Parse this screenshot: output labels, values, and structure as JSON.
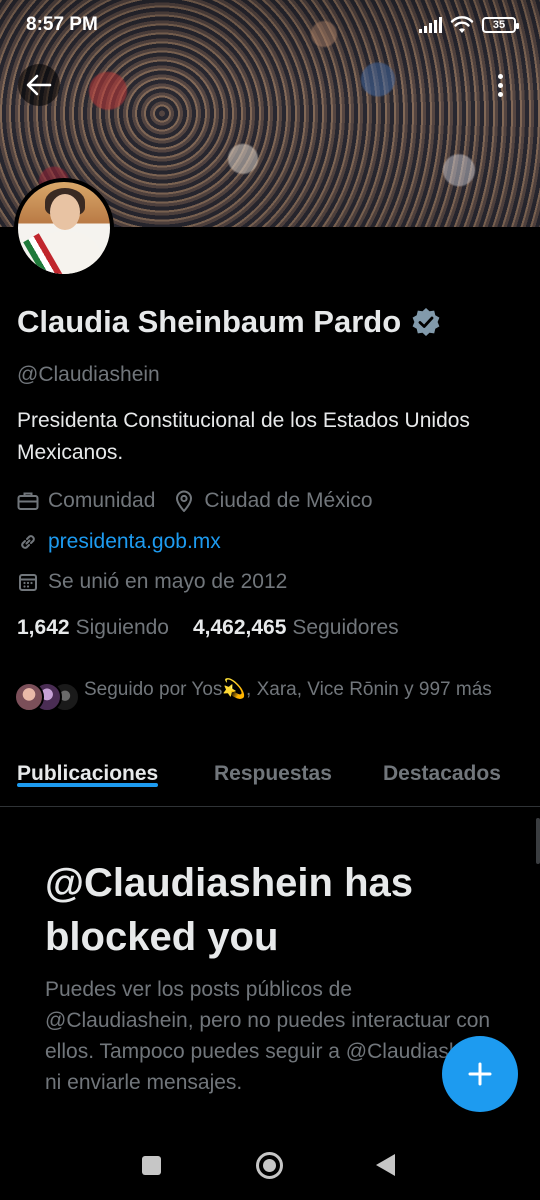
{
  "status_bar": {
    "time": "8:57 PM",
    "battery": "35",
    "icons": [
      "signal-icon",
      "wifi-icon",
      "battery-icon"
    ]
  },
  "header": {
    "back_icon": "arrow-left-icon",
    "more_icon": "more-vertical-icon"
  },
  "profile": {
    "name": "Claudia Sheinbaum Pardo",
    "verified_badge": "verified-badge-icon",
    "handle": "@Claudiashein",
    "bio": "Presidenta Constitucional de los Estados Unidos Mexicanos.",
    "category": "Comunidad",
    "location": "Ciudad de México",
    "website": "presidenta.gob.mx",
    "joined": "Se unió en mayo de 2012",
    "following_count": "1,642",
    "following_label": "Siguiendo",
    "followers_count": "4,462,465",
    "followers_label": "Seguidores",
    "followed_by": "Seguido por Yos💫, Xara, Vice Rōnin y 997 más"
  },
  "tabs": [
    {
      "label": "Publicaciones",
      "active": true
    },
    {
      "label": "Respuestas",
      "active": false
    },
    {
      "label": "Destacados",
      "active": false
    }
  ],
  "blocked": {
    "title": "@Claudiashein has blocked you",
    "body": "Puedes ver los posts públicos de @Claudiashein, pero no puedes interactuar con ellos. Tampoco puedes seguir a @Claudiashein ni enviarle mensajes."
  },
  "fab": {
    "icon": "plus-icon"
  },
  "colors": {
    "accent": "#1d9bf0",
    "background": "#000000",
    "text_primary": "#e7e9ea",
    "text_secondary": "#71767b",
    "verified_badge": "#829aab"
  }
}
